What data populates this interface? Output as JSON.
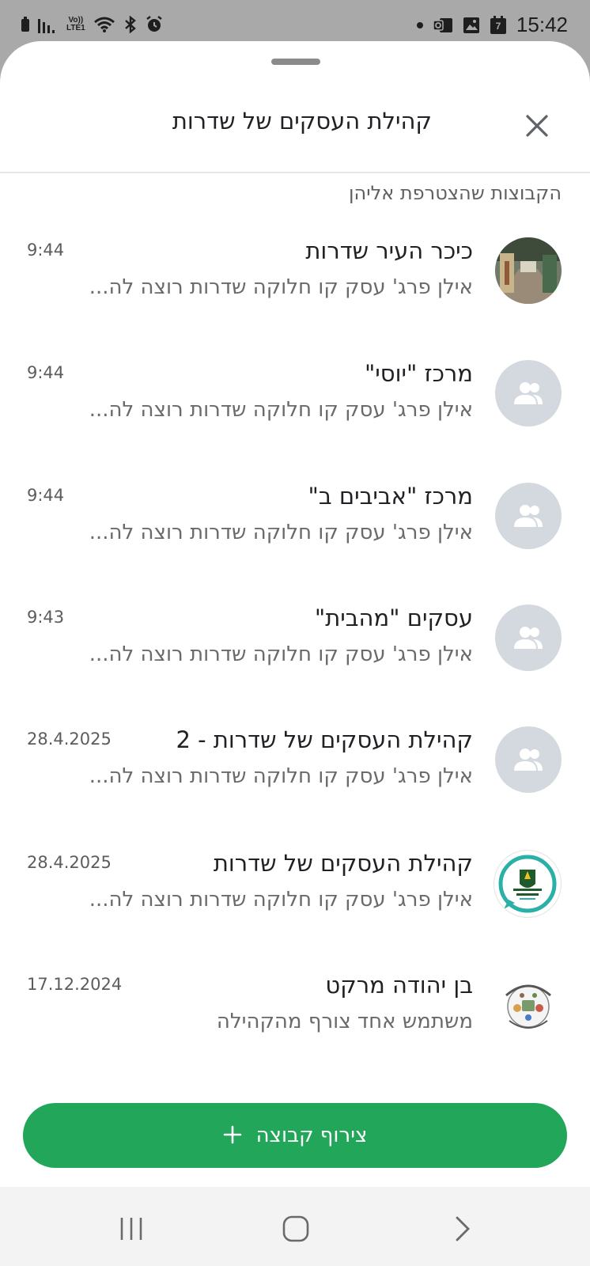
{
  "status_bar": {
    "time": "15:42",
    "network_label_top": "Vo))",
    "network_label_bottom": "LTE1",
    "calendar_day": "7"
  },
  "sheet": {
    "title": "קהילת העסקים של שדרות",
    "section_label": "הקבוצות שהצטרפת אליהן"
  },
  "groups": [
    {
      "name": "כיכר העיר שדרות",
      "preview": "אילן פרג' עסק קו חלוקה שדרות רוצה לה...",
      "time": "9:44",
      "avatar": "photo"
    },
    {
      "name": "מרכז \"יוסי\"",
      "preview": "אילן פרג' עסק קו חלוקה שדרות רוצה לה...",
      "time": "9:44",
      "avatar": "group-icon"
    },
    {
      "name": "מרכז \"אביבים ב\"",
      "preview": "אילן פרג' עסק קו חלוקה שדרות רוצה לה...",
      "time": "9:44",
      "avatar": "group-icon"
    },
    {
      "name": "עסקים \"מהבית\"",
      "preview": "אילן פרג' עסק קו חלוקה שדרות רוצה לה...",
      "time": "9:43",
      "avatar": "group-icon"
    },
    {
      "name": "קהילת העסקים של שדרות - 2",
      "preview": "אילן פרג' עסק קו חלוקה שדרות רוצה לה...",
      "time": "28.4.2025",
      "avatar": "group-icon"
    },
    {
      "name": "קהילת העסקים של שדרות",
      "preview": "אילן פרג' עסק קו חלוקה שדרות רוצה לה...",
      "time": "28.4.2025",
      "avatar": "logo"
    },
    {
      "name": "בן יהודה מרקט",
      "preview": "משתמש אחד צורף מהקהילה",
      "time": "17.12.2024",
      "avatar": "market-logo"
    }
  ],
  "add_group_button": {
    "label": "צירוף קבוצה",
    "icon": "plus-icon"
  },
  "colors": {
    "accent": "#21a65a",
    "avatar_placeholder": "#d3d9df"
  }
}
